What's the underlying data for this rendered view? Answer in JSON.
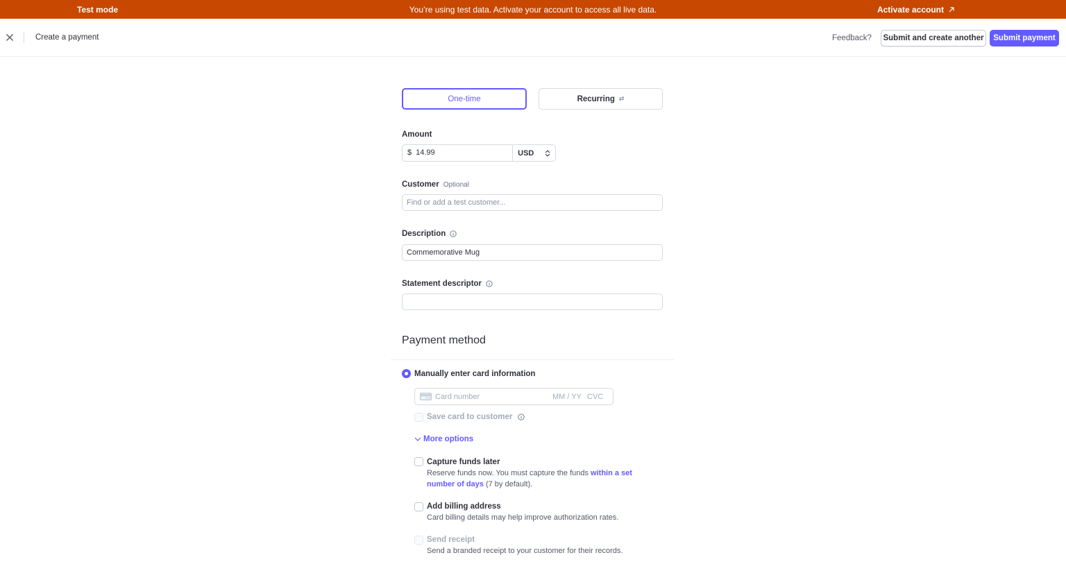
{
  "banner": {
    "mode_label": "Test mode",
    "message": "You’re using test data. Activate your account to access all live data.",
    "activate_label": "Activate account",
    "color": "#c84801"
  },
  "header": {
    "title": "Create a payment",
    "feedback_label": "Feedback?",
    "secondary_button": "Submit and create another",
    "primary_button": "Submit payment",
    "accent": "#635bff"
  },
  "form": {
    "segments": [
      {
        "label": "One-time",
        "active": true
      },
      {
        "label": "Recurring",
        "active": false,
        "icon": "recurring-icon"
      }
    ],
    "amount": {
      "label": "Amount",
      "currency_symbol": "$",
      "value": "14.99",
      "currency": "USD"
    },
    "customer": {
      "label": "Customer",
      "optional": "Optional",
      "placeholder": "Find or add a test customer..."
    },
    "description": {
      "label": "Description",
      "value": "Commemorative Mug"
    },
    "statement_descriptor": {
      "label": "Statement descriptor",
      "value": ""
    }
  },
  "payment_method": {
    "title": "Payment method",
    "manual_label": "Manually enter card information",
    "card": {
      "number_placeholder": "Card number",
      "expiry_placeholder": "MM / YY",
      "cvc_placeholder": "CVC"
    },
    "save_card_label": "Save card to customer",
    "more_options_label": "More options",
    "capture_later": {
      "label": "Capture funds later",
      "desc_prefix": "Reserve funds now. You must capture the funds ",
      "desc_link": "within a set number of days",
      "desc_suffix": " (7 by default)."
    },
    "billing_address": {
      "label": "Add billing address",
      "desc": "Card billing details may help improve authorization rates."
    },
    "send_receipt": {
      "label": "Send receipt",
      "desc": "Send a branded receipt to your customer for their records."
    }
  }
}
